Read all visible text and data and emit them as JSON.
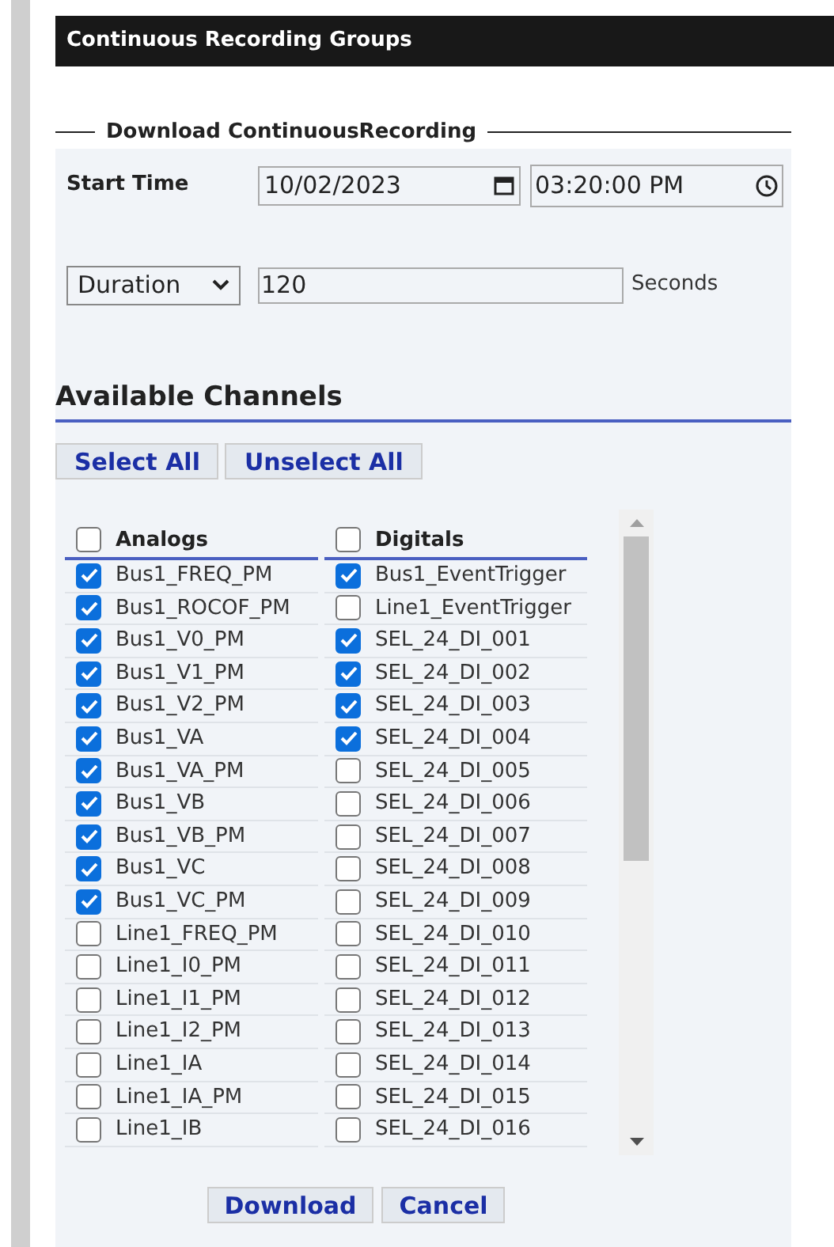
{
  "title": "Continuous Recording Groups",
  "legend": "Download ContinuousRecording",
  "start_time": {
    "label": "Start Time",
    "date": "10/02/2023",
    "time": "03:20:00 PM"
  },
  "duration": {
    "select": "Duration",
    "value": "120",
    "unit": "Seconds"
  },
  "channels_heading": "Available Channels",
  "select_buttons": [
    "Select All",
    "Unselect All"
  ],
  "columns": [
    {
      "label": "Analogs",
      "checked": false
    },
    {
      "label": "Digitals",
      "checked": false
    }
  ],
  "rows": [
    {
      "analog": {
        "name": "Bus1_FREQ_PM",
        "checked": true
      },
      "digital": {
        "name": "Bus1_EventTrigger",
        "checked": true
      }
    },
    {
      "analog": {
        "name": "Bus1_ROCOF_PM",
        "checked": true
      },
      "digital": {
        "name": "Line1_EventTrigger",
        "checked": false
      }
    },
    {
      "analog": {
        "name": "Bus1_V0_PM",
        "checked": true
      },
      "digital": {
        "name": "SEL_24_DI_001",
        "checked": true
      }
    },
    {
      "analog": {
        "name": "Bus1_V1_PM",
        "checked": true
      },
      "digital": {
        "name": "SEL_24_DI_002",
        "checked": true
      }
    },
    {
      "analog": {
        "name": "Bus1_V2_PM",
        "checked": true
      },
      "digital": {
        "name": "SEL_24_DI_003",
        "checked": true
      }
    },
    {
      "analog": {
        "name": "Bus1_VA",
        "checked": true
      },
      "digital": {
        "name": "SEL_24_DI_004",
        "checked": true
      }
    },
    {
      "analog": {
        "name": "Bus1_VA_PM",
        "checked": true
      },
      "digital": {
        "name": "SEL_24_DI_005",
        "checked": false
      }
    },
    {
      "analog": {
        "name": "Bus1_VB",
        "checked": true
      },
      "digital": {
        "name": "SEL_24_DI_006",
        "checked": false
      }
    },
    {
      "analog": {
        "name": "Bus1_VB_PM",
        "checked": true
      },
      "digital": {
        "name": "SEL_24_DI_007",
        "checked": false
      }
    },
    {
      "analog": {
        "name": "Bus1_VC",
        "checked": true
      },
      "digital": {
        "name": "SEL_24_DI_008",
        "checked": false
      }
    },
    {
      "analog": {
        "name": "Bus1_VC_PM",
        "checked": true
      },
      "digital": {
        "name": "SEL_24_DI_009",
        "checked": false
      }
    },
    {
      "analog": {
        "name": "Line1_FREQ_PM",
        "checked": false
      },
      "digital": {
        "name": "SEL_24_DI_010",
        "checked": false
      }
    },
    {
      "analog": {
        "name": "Line1_I0_PM",
        "checked": false
      },
      "digital": {
        "name": "SEL_24_DI_011",
        "checked": false
      }
    },
    {
      "analog": {
        "name": "Line1_I1_PM",
        "checked": false
      },
      "digital": {
        "name": "SEL_24_DI_012",
        "checked": false
      }
    },
    {
      "analog": {
        "name": "Line1_I2_PM",
        "checked": false
      },
      "digital": {
        "name": "SEL_24_DI_013",
        "checked": false
      }
    },
    {
      "analog": {
        "name": "Line1_IA",
        "checked": false
      },
      "digital": {
        "name": "SEL_24_DI_014",
        "checked": false
      }
    },
    {
      "analog": {
        "name": "Line1_IA_PM",
        "checked": false
      },
      "digital": {
        "name": "SEL_24_DI_015",
        "checked": false
      }
    },
    {
      "analog": {
        "name": "Line1_IB",
        "checked": false
      },
      "digital": {
        "name": "SEL_24_DI_016",
        "checked": false
      }
    }
  ],
  "buttons": [
    "Download",
    "Cancel"
  ]
}
